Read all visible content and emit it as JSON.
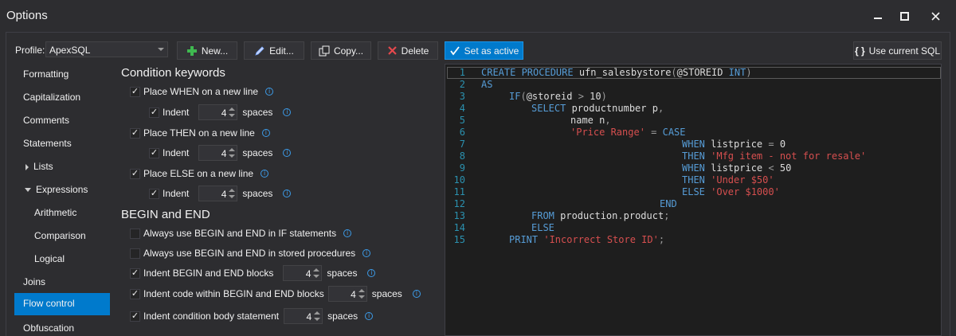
{
  "window": {
    "title": "Options",
    "minimize_icon": "minimize-icon",
    "maximize_icon": "maximize-icon",
    "close_icon": "close-icon"
  },
  "toolbar": {
    "profile_label": "Profile:",
    "profile_value": "ApexSQL",
    "new_label": "New...",
    "edit_label": "Edit...",
    "copy_label": "Copy...",
    "delete_label": "Delete",
    "set_active_label": "Set as active",
    "use_current_sql_label": "Use current SQL",
    "use_current_sql_icon_text": "{ }"
  },
  "sidebar": {
    "items": [
      {
        "label": "Formatting"
      },
      {
        "label": "Capitalization"
      },
      {
        "label": "Comments"
      },
      {
        "label": "Statements"
      },
      {
        "label": "Lists"
      },
      {
        "label": "Expressions"
      },
      {
        "label": "Arithmetic"
      },
      {
        "label": "Comparison"
      },
      {
        "label": "Logical"
      },
      {
        "label": "Joins"
      },
      {
        "label": "Flow control"
      },
      {
        "label": "Obfuscation"
      }
    ],
    "selected": "Flow control"
  },
  "condition_keywords": {
    "heading": "Condition keywords",
    "when_label": "Place WHEN on a new line",
    "then_label": "Place THEN on a new line",
    "else_label": "Place ELSE on a new line",
    "indent_label": "Indent",
    "spaces_label": "spaces",
    "when_indent": "4",
    "then_indent": "4",
    "else_indent": "4"
  },
  "begin_end": {
    "heading": "BEGIN and END",
    "if_label": "Always use BEGIN and END in IF statements",
    "proc_label": "Always use BEGIN and END in stored procedures",
    "indent_blocks_label": "Indent BEGIN and END blocks",
    "indent_code_label": "Indent code within BEGIN and END blocks",
    "indent_cond_label": "Indent condition body statement",
    "spaces_label": "spaces",
    "indent_blocks_value": "4",
    "indent_code_value": "4",
    "indent_cond_value": "4"
  },
  "check_mark": "✓",
  "info_mark": "i",
  "editor": {
    "lines": [
      {
        "n": "1"
      },
      {
        "n": "2"
      },
      {
        "n": "3"
      },
      {
        "n": "4"
      },
      {
        "n": "5"
      },
      {
        "n": "6"
      },
      {
        "n": "7"
      },
      {
        "n": "8"
      },
      {
        "n": "9"
      },
      {
        "n": "10"
      },
      {
        "n": "11"
      },
      {
        "n": "12"
      },
      {
        "n": "13"
      },
      {
        "n": "14"
      },
      {
        "n": "15"
      }
    ],
    "t": {
      "create": "CREATE PROCEDURE",
      "procname": " ufn_salesbystore",
      "lparen": "(",
      "param": "@STOREID",
      "int": " INT",
      "rparen": ")",
      "as": "AS",
      "if": "IF",
      "lp2": "(",
      "storeid": "@storeid",
      "gt": " > ",
      "ten": "10",
      "rp2": ")",
      "select": "SELECT",
      "productnumber": " productnumber p",
      "comma": ",",
      "name": "name n",
      "pricerange": "'Price Range'",
      "eq": " = ",
      "case": "CASE",
      "when1": "WHEN",
      "lp_eq": " listprice ",
      "eq2": "=",
      "zero": " 0",
      "then1": "THEN",
      "mfg": " 'Mfg item - not for resale'",
      "when2": "WHEN",
      "lp_lt": " listprice ",
      "lt": "<",
      "fifty": " 50",
      "then2": "THEN",
      "under": " 'Under $50'",
      "else1": "ELSE",
      "over": " 'Over $1000'",
      "end": "END",
      "from": "FROM",
      "prod": " production",
      "dot": ".",
      "product": "product",
      "semi": ";",
      "else2": "ELSE",
      "print": "PRINT",
      "incorrect": " 'Incorrect Store ID'",
      "semi2": ";"
    }
  }
}
